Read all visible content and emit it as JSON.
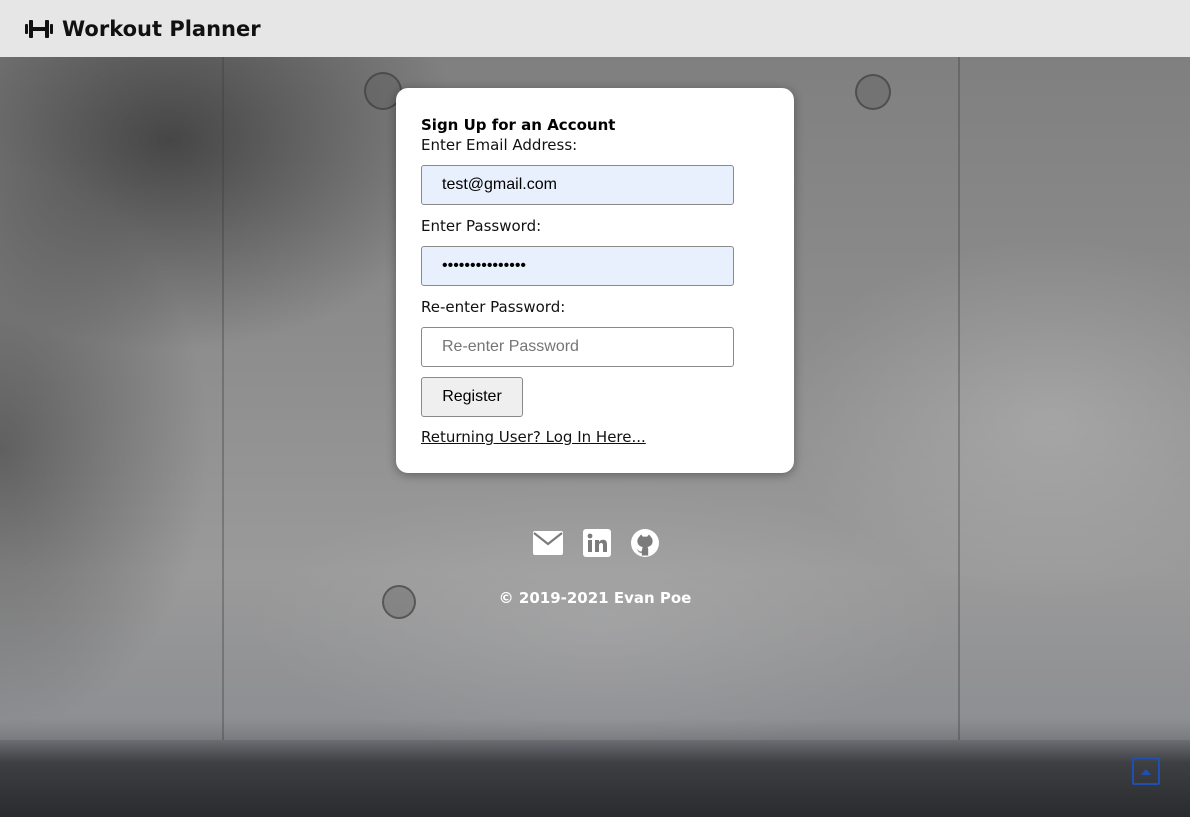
{
  "header": {
    "title": "Workout Planner",
    "logo_icon": "dumbbell-icon"
  },
  "signup": {
    "title": "Sign Up for an Account",
    "email_label": "Enter Email Address:",
    "email_value": "test@gmail.com",
    "password_label": "Enter Password:",
    "password_value": "•••••••••••••••",
    "reenter_label": "Re-enter Password:",
    "reenter_placeholder": "Re-enter Password",
    "register_label": "Register",
    "login_link": "Returning User? Log In Here..."
  },
  "footer": {
    "social_icons": [
      "envelope-icon",
      "linkedin-icon",
      "github-icon"
    ],
    "copyright": "© 2019-2021 Evan Poe",
    "scroll_top_icon": "arrow-up-icon"
  },
  "colors": {
    "header_bg": "#e6e6e6",
    "autofill_bg": "#e8f0fe",
    "scroll_top_accent": "#1f4fb0"
  }
}
